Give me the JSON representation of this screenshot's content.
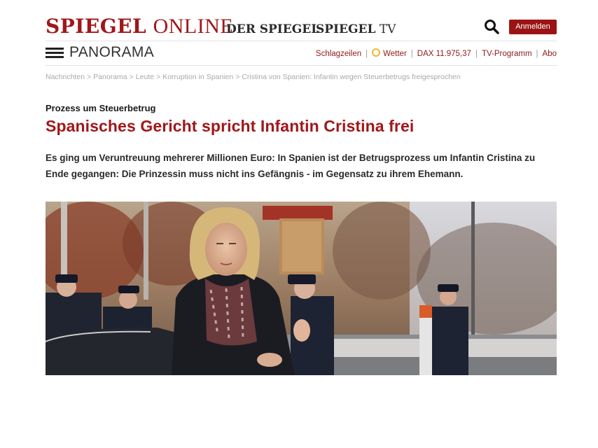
{
  "brand": {
    "main_bold": "SPIEGEL",
    "main_light": "ONLINE",
    "der_spiegel": "DER SPIEGEL",
    "tv_bold": "SPIEGEL",
    "tv_light": "TV",
    "login_label": "Anmelden",
    "search_icon": "search-icon"
  },
  "section": {
    "menu_icon": "hamburger-menu-icon",
    "title": "PANORAMA",
    "links": {
      "headlines": "Schlagzeilen",
      "weather": "Wetter",
      "dax": "DAX 11.975,37",
      "tv_program": "TV-Programm",
      "subscribe": "Abo"
    }
  },
  "breadcrumb": [
    "Nachrichten",
    "Panorama",
    "Leute",
    "Korruption in Spanien",
    "Cristina von Spanien: Infantin wegen Steuerbetrugs freigesprochen"
  ],
  "article": {
    "kicker": "Prozess um Steuerbetrug",
    "headline": "Spanisches Gericht spricht Infantin Cristina frei",
    "teaser": "Es ging um Veruntreuung mehrerer Millionen Euro: In Spanien ist der Betrugsprozess um Infantin Cristina zu Ende gegangen: Die Prinzessin muss nicht ins Gefängnis - im Gegensatz zu ihrem Ehemann."
  },
  "colors": {
    "brand_red": "#a0171b",
    "button_red": "#9b1414",
    "link_red": "#8e1a1e",
    "muted_gray": "#a8a8a8"
  }
}
